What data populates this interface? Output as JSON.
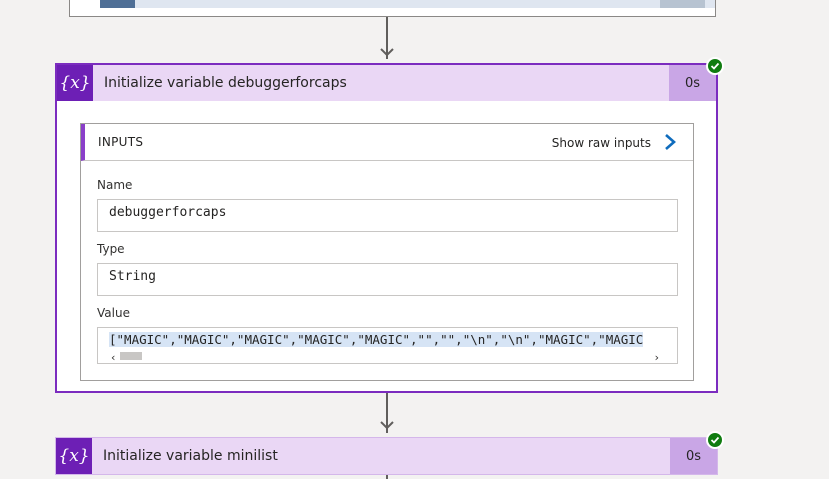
{
  "actions": [
    {
      "title": "Initialize variable debuggerforcaps",
      "duration": "0s",
      "status": "succeeded",
      "icon": "variable-icon",
      "icon_glyph": "{x}",
      "inputs": {
        "header": "INPUTS",
        "show_raw_label": "Show raw inputs",
        "fields": [
          {
            "label": "Name",
            "value": "debuggerforcaps"
          },
          {
            "label": "Type",
            "value": "String"
          },
          {
            "label": "Value",
            "value": "[\"MAGIC\",\"MAGIC\",\"MAGIC\",\"MAGIC\",\"MAGIC\",\"\",\"\",\"\\n\",\"\\n\",\"MAGIC\",\"MAGIC"
          }
        ]
      }
    },
    {
      "title": "Initialize variable minilist",
      "duration": "0s",
      "status": "succeeded",
      "icon": "variable-icon",
      "icon_glyph": "{x}"
    }
  ],
  "colors": {
    "accent": "#6d1fb5",
    "header_bg": "#ead7f5",
    "duration_bg": "#c9a6e6",
    "success": "#107c10",
    "link_chevron": "#0f6cbd"
  }
}
